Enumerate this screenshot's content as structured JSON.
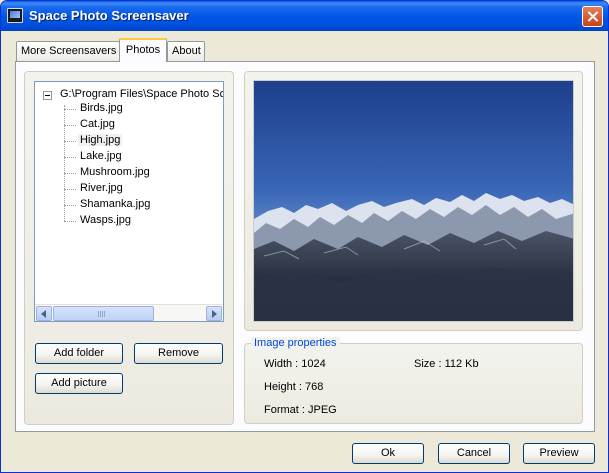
{
  "window": {
    "title": "Space Photo Screensaver"
  },
  "tabs": [
    {
      "label": "More Screensavers"
    },
    {
      "label": "Photos"
    },
    {
      "label": "About"
    }
  ],
  "tree": {
    "root": "G:\\Program Files\\Space Photo Sc",
    "items": [
      {
        "label": "Birds.jpg"
      },
      {
        "label": "Cat.jpg"
      },
      {
        "label": "High.jpg"
      },
      {
        "label": "Lake.jpg"
      },
      {
        "label": "Mushroom.jpg"
      },
      {
        "label": "River.jpg"
      },
      {
        "label": "Shamanka.jpg"
      },
      {
        "label": "Wasps.jpg"
      }
    ],
    "selected": "High.jpg"
  },
  "buttons": {
    "add_folder": "Add folder",
    "remove": "Remove",
    "add_picture": "Add picture",
    "ok": "Ok",
    "cancel": "Cancel",
    "preview": "Preview"
  },
  "image_properties": {
    "legend": "Image properties",
    "width": "Width : 1024",
    "size": "Size : 112 Kb",
    "height": "Height : 768",
    "format": "Format : JPEG"
  },
  "colors": {
    "accent": "#0046D5",
    "titlebar": "#0055E5",
    "tab_highlight": "#FFC83C"
  }
}
